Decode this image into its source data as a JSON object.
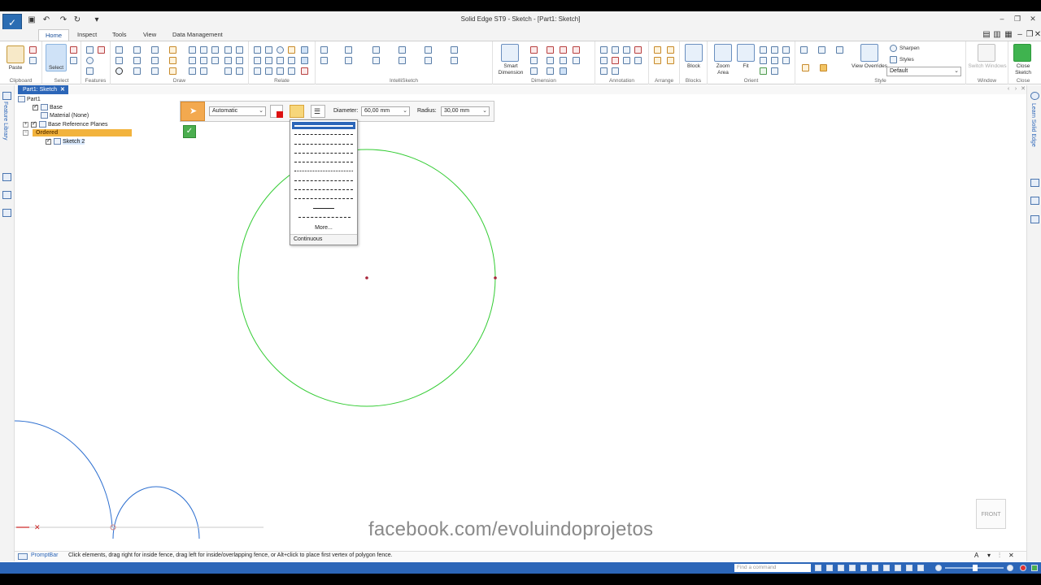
{
  "window": {
    "title": "Solid Edge ST9 - Sketch - [Part1: Sketch]"
  },
  "tabs": [
    "Home",
    "Inspect",
    "Tools",
    "View",
    "Data Management"
  ],
  "ribbon": {
    "groups": [
      "Clipboard",
      "Select",
      "Features",
      "Draw",
      "Relate",
      "IntelliSketch",
      "Dimension",
      "Annotation",
      "Arrange",
      "Blocks",
      "Orient",
      "Style",
      "Window",
      "Close"
    ],
    "buttons": {
      "paste": "Paste",
      "select": "Select",
      "smart_dimension": "Smart Dimension",
      "block": "Block",
      "zoom_area": "Zoom Area",
      "fit": "Fit",
      "view_overrides": "View Overrides",
      "sharpen": "Sharpen",
      "styles": "Styles",
      "style_value": "Default",
      "switch_windows": "Switch Windows",
      "close_sketch": "Close Sketch"
    }
  },
  "doc_tab": "Part1: Sketch",
  "left_rail": {
    "feature_library": "Feature Library"
  },
  "right_rail": {
    "learn": "Learn Solid Edge"
  },
  "tree": {
    "root": "Part1",
    "items": [
      "Base",
      "Material (None)",
      "Base Reference Planes",
      "Ordered",
      "Sketch 2"
    ]
  },
  "command_bar": {
    "mode_value": "Automatic",
    "diameter_label": "Diameter:",
    "diameter_value": "60,00 mm",
    "radius_label": "Radius:",
    "radius_value": "30,00 mm"
  },
  "linestyle_menu": {
    "more_label": "More...",
    "current": "Continuous"
  },
  "promptbar": {
    "label": "PromptBar",
    "message": "Click elements, drag right for inside fence, drag left for inside/overlapping fence, or Alt+click to place first vertex of polygon fence."
  },
  "statusbar": {
    "command_placeholder": "Find a command"
  },
  "view_cube": "FRONT",
  "watermark": "facebook.com/evoluindoprojetos",
  "colors": {
    "accent": "#2c66b8",
    "sketch_circle": "#33cc33",
    "profile_curves": "#2d6fd0",
    "ordered_highlight": "#f2b33d"
  }
}
